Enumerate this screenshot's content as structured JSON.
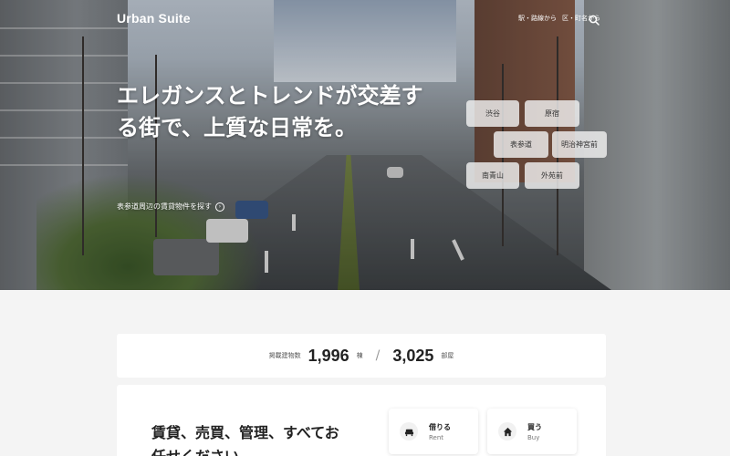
{
  "brand": {
    "name": "Urban Suite"
  },
  "nav": {
    "items": [
      "駅・路線から",
      "区・町名から"
    ],
    "search_icon": "search-icon"
  },
  "hero": {
    "headline": "エレガンスとトレンドが交差する街で、上質な日常を。",
    "sublink": "表参道周辺の賃貸物件を探す",
    "sublink_icon": "circle-arrow-right-icon",
    "stations": [
      "渋谷",
      "原宿",
      "表参道",
      "明治神宮前",
      "南青山",
      "外苑前"
    ]
  },
  "stats": {
    "label": "掲載建物数",
    "buildings": "1,996",
    "buildings_unit": "棟",
    "rooms": "3,025",
    "rooms_unit": "部屋"
  },
  "services": {
    "title": "賃貸、売買、管理、すべてお任せください",
    "items": [
      {
        "jp": "借りる",
        "en": "Rent",
        "icon": "sofa-icon"
      },
      {
        "jp": "買う",
        "en": "Buy",
        "icon": "house-icon"
      }
    ]
  },
  "colors": {
    "page_bg": "#f4f4f4",
    "card_bg": "#ffffff",
    "hero_text": "#ffffff"
  }
}
